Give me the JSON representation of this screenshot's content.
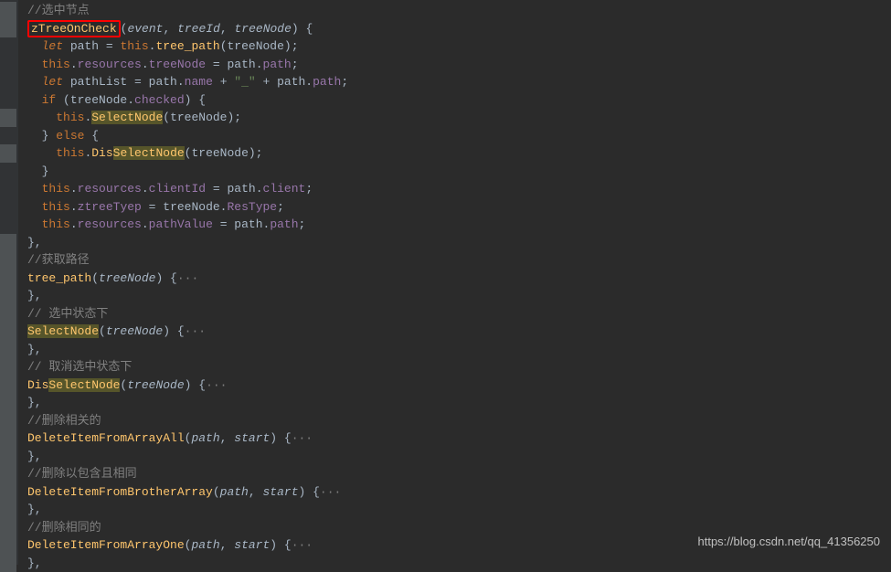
{
  "code": {
    "c1": "//选中节点",
    "fn1": "zTreeOnCheck",
    "p_event": "event",
    "p_treeId": "treeId",
    "p_treeNode": "treeNode",
    "let": "let",
    "path_var": "path",
    "this": "this",
    "tree_path_call": "tree_path",
    "resources": "resources",
    "treeNodeProp": "treeNode",
    "pathProp": "path",
    "pathList": "pathList",
    "name": "name",
    "underscore": "\"_\"",
    "if": "if",
    "checked": "checked",
    "SelectNode": "SelectNode",
    "else": "else",
    "Dis": "Dis",
    "clientId": "clientId",
    "client": "client",
    "ztreeTyep": "ztreeTyep",
    "ResType": "ResType",
    "pathValue": "pathValue",
    "c2": "//获取路径",
    "tree_path_fn": "tree_path",
    "c3": "// 选中状态下",
    "c4": "// 取消选中状态下",
    "DisSelectNode": "DisSelectNode",
    "c5": "//删除相关的",
    "DeleteItemFromArrayAll": "DeleteItemFromArrayAll",
    "p_path": "path",
    "p_start": "start",
    "c6": "//删除以包含且相同",
    "DeleteItemFromBrotherArray": "DeleteItemFromBrotherArray",
    "c7": "//删除相同的",
    "DeleteItemFromArrayOne": "DeleteItemFromArrayOne",
    "fold": "···"
  },
  "watermark": "https://blog.csdn.net/qq_41356250"
}
